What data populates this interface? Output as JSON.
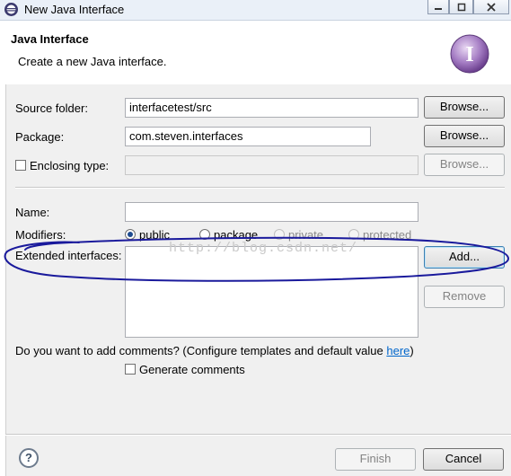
{
  "window": {
    "title": "New Java Interface"
  },
  "banner": {
    "heading": "Java Interface",
    "description": "Create a new Java interface."
  },
  "form": {
    "source_folder": {
      "label": "Source folder:",
      "value": "interfacetest/src",
      "browse_label": "Browse..."
    },
    "package": {
      "label": "Package:",
      "value": "com.steven.interfaces",
      "browse_label": "Browse..."
    },
    "enclosing_type": {
      "label": "Enclosing type:",
      "value": "",
      "browse_label": "Browse..."
    },
    "name": {
      "label": "Name:",
      "value": ""
    },
    "modifiers": {
      "label": "Modifiers:",
      "options": [
        "public",
        "package",
        "private",
        "protected"
      ],
      "selected": "public"
    },
    "extended_interfaces": {
      "label": "Extended interfaces:",
      "add_label": "Add...",
      "remove_label": "Remove"
    },
    "comments": {
      "question": "Do you want to add comments? (Configure templates and default value ",
      "link": "here",
      "close": ")",
      "generate_label": "Generate comments"
    }
  },
  "watermark": "http://blog.csdn.net/",
  "footer": {
    "help_icon": "?",
    "finish_label": "Finish",
    "cancel_label": "Cancel"
  },
  "colors": {
    "annotation_ink": "#1a1a9c",
    "link": "#0066cc",
    "dialog_bg": "#f0f0f0"
  }
}
